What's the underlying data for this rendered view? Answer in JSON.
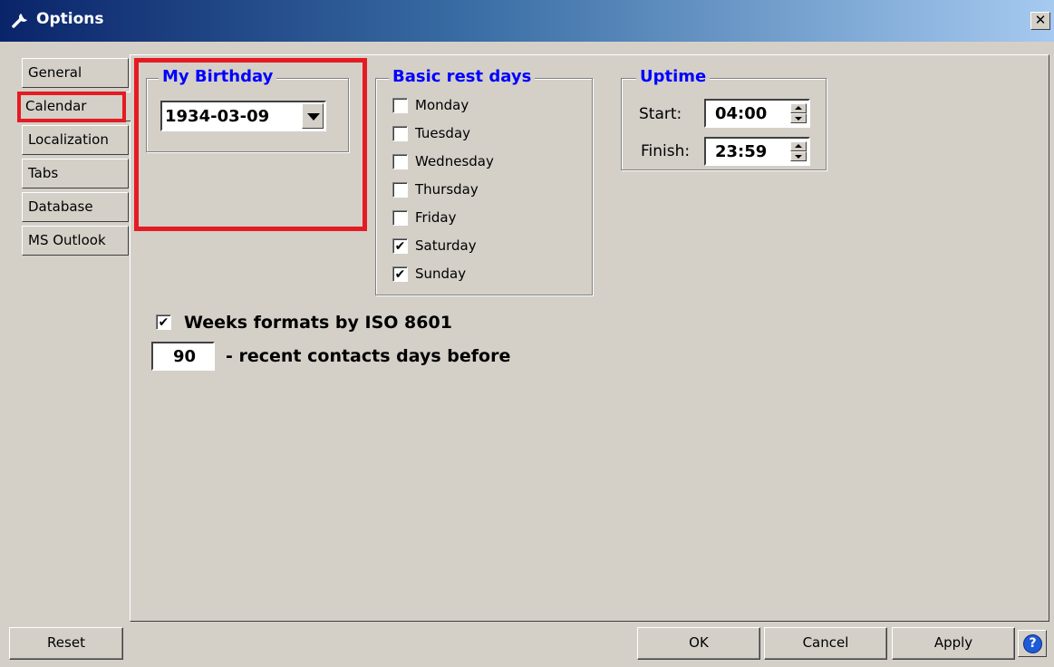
{
  "window": {
    "title": "Options",
    "close_glyph": "✕"
  },
  "tabs": [
    {
      "label": "General"
    },
    {
      "label": "Calendar",
      "active": true
    },
    {
      "label": "Localization"
    },
    {
      "label": "Tabs"
    },
    {
      "label": "Database"
    },
    {
      "label": "MS Outlook"
    }
  ],
  "birthday": {
    "legend": "My Birthday",
    "value": "1934-03-09"
  },
  "rest_days": {
    "legend": "Basic rest days",
    "days": [
      {
        "label": "Monday",
        "checked": false
      },
      {
        "label": "Tuesday",
        "checked": false
      },
      {
        "label": "Wednesday",
        "checked": false
      },
      {
        "label": "Thursday",
        "checked": false
      },
      {
        "label": "Friday",
        "checked": false
      },
      {
        "label": "Saturday",
        "checked": true
      },
      {
        "label": "Sunday",
        "checked": true
      }
    ]
  },
  "uptime": {
    "legend": "Uptime",
    "start_label": "Start:",
    "start_value": "04:00",
    "finish_label": "Finish:",
    "finish_value": "23:59"
  },
  "iso_weeks": {
    "label": "Weeks formats by ISO 8601",
    "checked": true
  },
  "recent_contacts": {
    "value": "90",
    "label": "- recent contacts days before"
  },
  "buttons": {
    "reset": "Reset",
    "ok": "OK",
    "cancel": "Cancel",
    "apply": "Apply",
    "help": "?"
  },
  "colors": {
    "annotation": "#e41b23",
    "legend": "#0000ff",
    "title_bar": "#0a246a"
  }
}
